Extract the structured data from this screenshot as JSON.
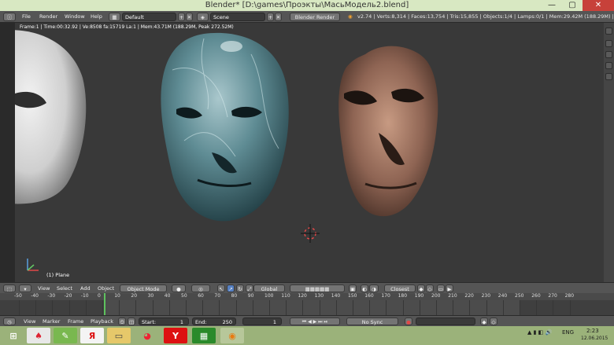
{
  "window": {
    "title": "Blender* [D:\\games\\Проэкты\\МасьМодель2.blend]",
    "minimize": "—",
    "maximize": "▢",
    "close": "✕"
  },
  "info_header": {
    "menus": [
      "File",
      "Render",
      "Window",
      "Help"
    ],
    "layout": "Default",
    "scene": "Scene",
    "engine": "Blender Render",
    "stats": "v2.74 | Verts:8,314 | Faces:13,754 | Tris:15,855 | Objects:1/4 | Lamps:0/1 | Mem:29.42M (188.29M) | Plane"
  },
  "viewport": {
    "info": "Frame:1 | Time:00:32.92 | Ve:8508 fa:15719 La:1 | Mem:43.71M (188.29M, Peak 272.52M)",
    "object_label": "(1) Plane"
  },
  "view3d_header": {
    "menus": [
      "View",
      "Select",
      "Add",
      "Object"
    ],
    "mode": "Object Mode",
    "orientation": "Global",
    "snap_target": "Closest"
  },
  "timeline": {
    "ticks": [
      "-50",
      "-40",
      "-30",
      "-20",
      "-10",
      "0",
      "10",
      "20",
      "30",
      "40",
      "50",
      "60",
      "70",
      "80",
      "90",
      "100",
      "110",
      "120",
      "130",
      "140",
      "150",
      "160",
      "170",
      "180",
      "190",
      "200",
      "210",
      "220",
      "230",
      "240",
      "250",
      "260",
      "270",
      "280"
    ],
    "menus": [
      "View",
      "Marker",
      "Frame",
      "Playback"
    ],
    "start_label": "Start:",
    "start_value": "1",
    "end_label": "End:",
    "end_value": "250",
    "current_frame": "1",
    "sync": "No Sync",
    "current_frame_value": 1,
    "frame_start": 1,
    "frame_end": 250
  },
  "taskbar": {
    "lang": "ENG",
    "time": "2:23",
    "date": "12.06.2015"
  },
  "colors": {
    "viewport_bg": "#393939",
    "header_bg": "#555555",
    "taskbar_bg": "#9bb27a",
    "titlebar_bg": "#d8e8c2",
    "close_btn": "#c7413a",
    "frame_cursor": "#5ec25e"
  }
}
